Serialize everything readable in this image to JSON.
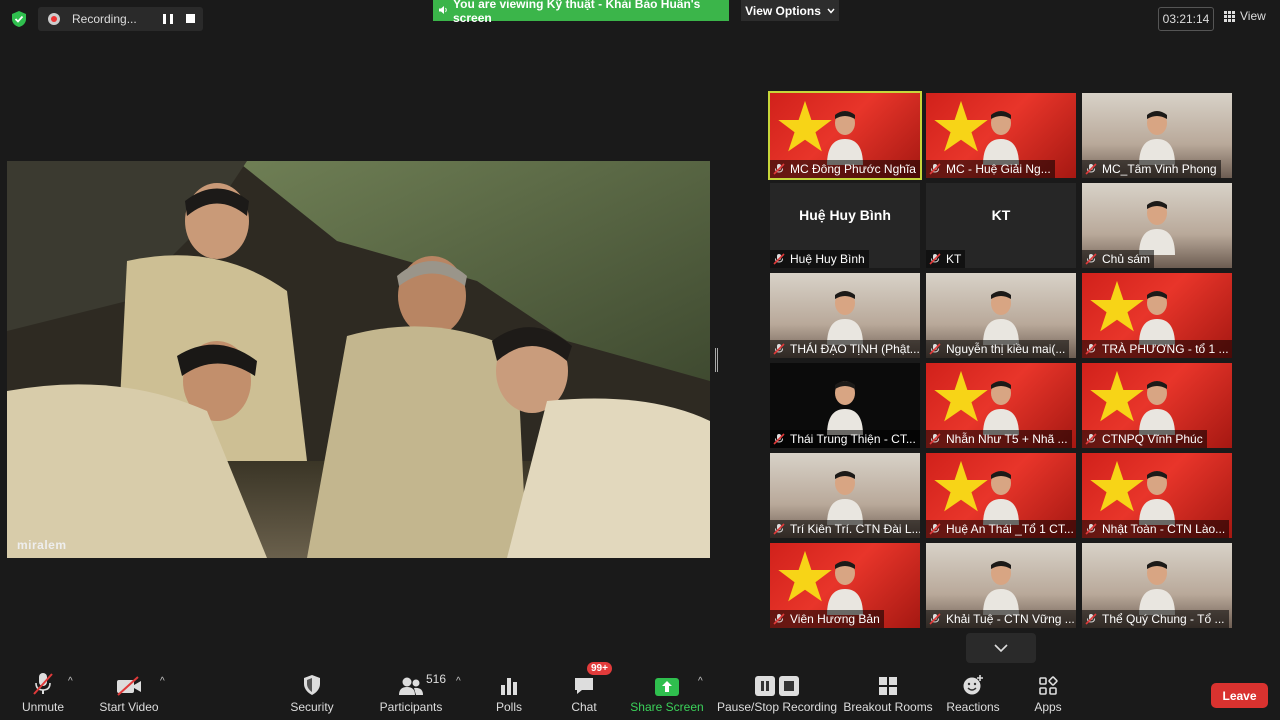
{
  "topbar": {
    "recording_label": "Recording...",
    "viewing_text": "You are viewing Kỹ thuật - Khải Bảo Huấn's screen",
    "view_options_label": "View Options",
    "timer": "03:21:14",
    "view_label": "View"
  },
  "shared_screen": {
    "watermark": "miralem"
  },
  "gallery": {
    "tiles": [
      {
        "name": "MC Đông Phước Nghĩa",
        "bg": "flag",
        "active": true
      },
      {
        "name": "MC - Huệ Giải Ng...",
        "bg": "flag"
      },
      {
        "name": "MC_Tâm Vinh Phong",
        "bg": "room"
      },
      {
        "name": "Huệ Huy Bình",
        "bg": "plain",
        "big_name": "Huệ Huy Bình"
      },
      {
        "name": "KT",
        "bg": "plain",
        "big_name": "KT"
      },
      {
        "name": "Chủ sám",
        "bg": "room"
      },
      {
        "name": "THÁI ĐẠO TỊNH (Phật...",
        "bg": "room"
      },
      {
        "name": "Nguyễn thị kiều mai(...",
        "bg": "room"
      },
      {
        "name": "TRÀ PHƯƠNG - tổ 1 ...",
        "bg": "flag"
      },
      {
        "name": "Thái Trung Thiện - CT...",
        "bg": "dark"
      },
      {
        "name": "Nhẫn Như T5 + Nhã ...",
        "bg": "flag"
      },
      {
        "name": "CTNPQ Vĩnh Phúc",
        "bg": "flag"
      },
      {
        "name": "Trí Kiên Trí. CTN Đài L...",
        "bg": "room"
      },
      {
        "name": "Huệ An Thái _Tổ 1 CT...",
        "bg": "flag"
      },
      {
        "name": "Nhật Toàn - CTN Lào...",
        "bg": "flag"
      },
      {
        "name": "Viên Hương Bản",
        "bg": "flag"
      },
      {
        "name": "Khải Tuệ - CTN Vững ...",
        "bg": "room"
      },
      {
        "name": "Thể Quý Chung - Tổ ...",
        "bg": "room"
      }
    ]
  },
  "toolbar": {
    "unmute": "Unmute",
    "start_video": "Start Video",
    "security": "Security",
    "participants": "Participants",
    "participant_count": "516",
    "polls": "Polls",
    "chat": "Chat",
    "chat_badge": "99+",
    "share_screen": "Share Screen",
    "pause_recording": "Pause/Stop Recording",
    "breakout_rooms": "Breakout Rooms",
    "reactions": "Reactions",
    "apps": "Apps",
    "leave": "Leave"
  },
  "colors": {
    "accent_green": "#3bb54a",
    "leave_red": "#d9322f",
    "active_speaker": "#c7d63a"
  }
}
